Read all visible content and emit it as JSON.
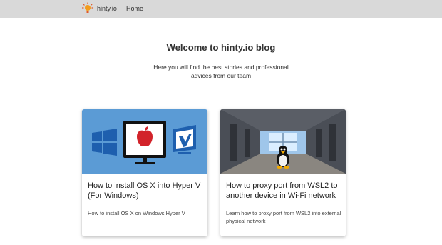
{
  "navbar": {
    "brand_label": "hinty.io",
    "brand_icon": "lightbulb-logo-icon",
    "home_label": "Home",
    "background": "#d9d9d9"
  },
  "hero": {
    "title": "Welcome to hinty.io blog",
    "subtitle": "Here you will find the best stories and professional advices from our team"
  },
  "cards": [
    {
      "title": "How to install OS X into Hyper V (For Windows)",
      "description": "How to install OS X on Windows Hyper V",
      "image": "windows-apple-hyperv-logos-image"
    },
    {
      "title": "How to proxy port from WSL2 to another device in Wi-Fi network",
      "description": "Learn how to proxy port from WSL2 into external physical network",
      "image": "linux-penguin-corridor-image"
    }
  ],
  "colors": {
    "card_image_bg_1": "#5b9bd5",
    "brand_orange": "#f29b1d"
  }
}
